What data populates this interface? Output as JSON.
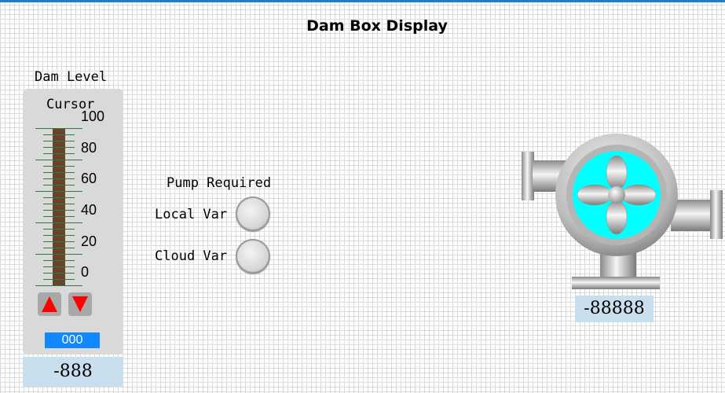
{
  "title": "Dam Box Display",
  "dam_level": {
    "label": "Dam Level",
    "cursor_label": "Cursor",
    "scale": [
      "100",
      "80",
      "60",
      "40",
      "20",
      "0"
    ],
    "cursor_value": "000",
    "readout": "-888",
    "up_icon": "arrow-up-icon",
    "down_icon": "arrow-down-icon",
    "bar_color": "#6b4230",
    "tick_color": "#2e7d32"
  },
  "pump_required": {
    "label": "Pump Required",
    "indicators": [
      {
        "label": "Local Var"
      },
      {
        "label": "Cloud Var"
      }
    ]
  },
  "pump": {
    "icon": "centrifugal-pump-icon",
    "impeller_color": "#00ffff",
    "readout": "-88888"
  },
  "colors": {
    "accent": "#1f7ed3",
    "readout_bg": "#c9dfee",
    "cursor_bg": "#1188ff",
    "arrow": "#ff0000"
  }
}
